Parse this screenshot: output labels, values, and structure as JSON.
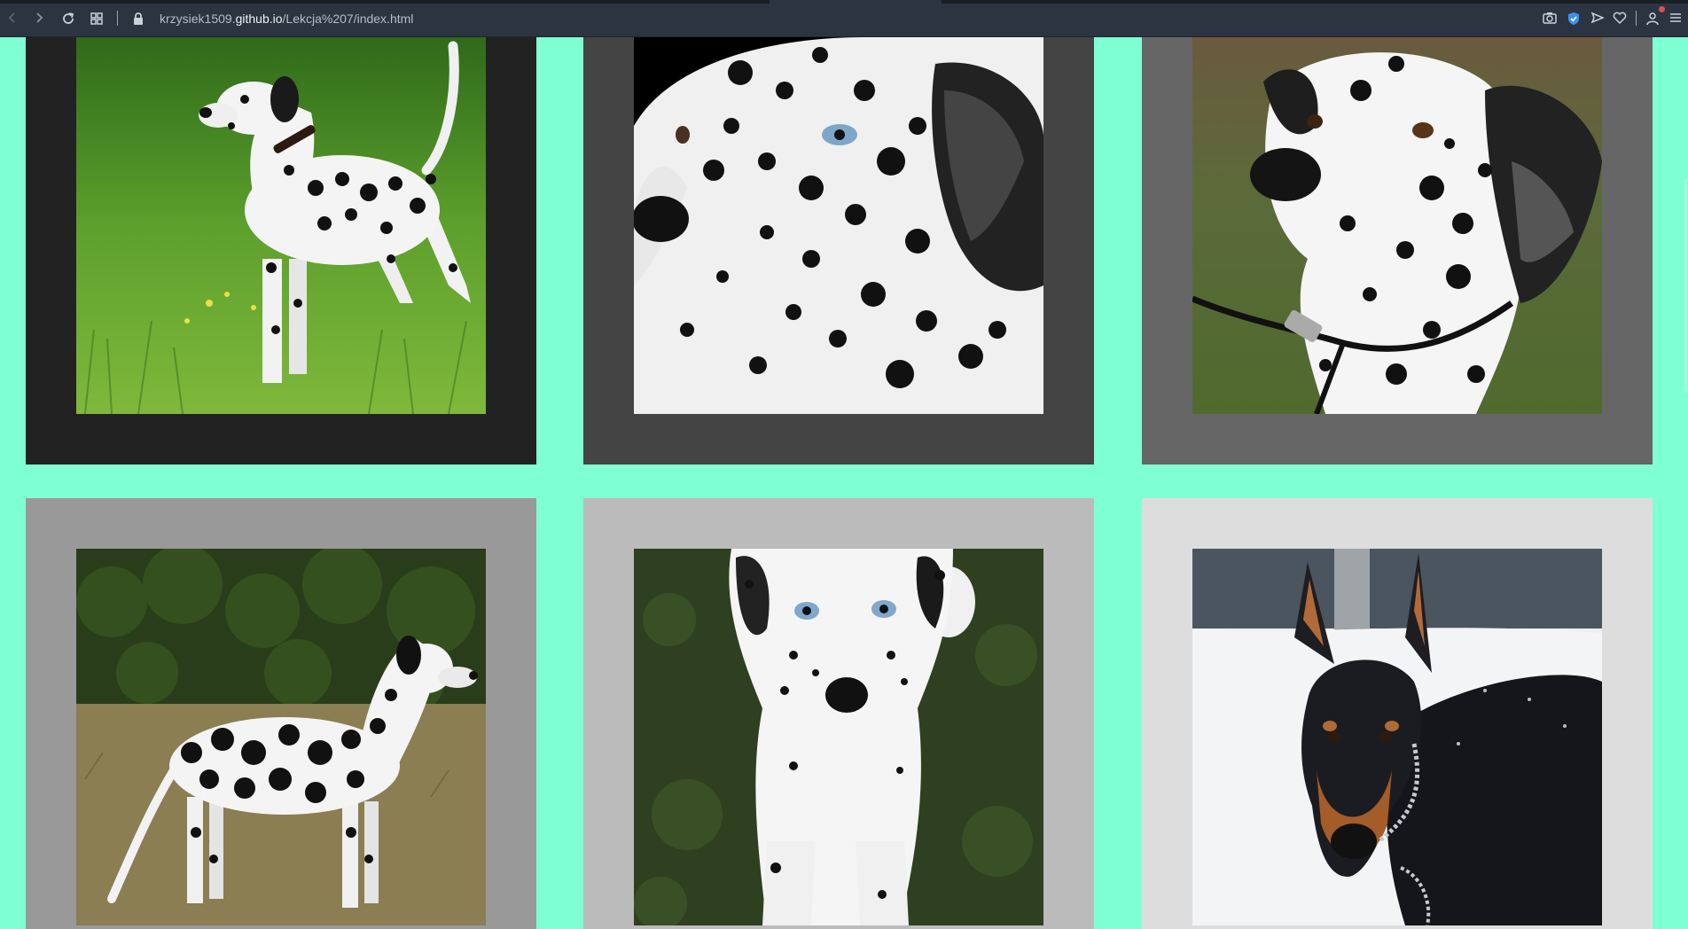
{
  "browser": {
    "url_prefix": "krzysiek1509.",
    "url_domain": "github.io",
    "url_path": "/Lekcja%207/index.html",
    "icons": [
      "back-icon",
      "forward-icon",
      "reload-icon",
      "tab-grid-icon",
      "lock-icon",
      "camera-icon",
      "shield-icon",
      "send-icon",
      "heart-icon",
      "profile-icon",
      "menu-icon"
    ]
  },
  "colors": {
    "page_background": "#7fffd4",
    "card_backgrounds": [
      "#222222",
      "#444444",
      "#666666",
      "#999999",
      "#bbbbbb",
      "#dddddd"
    ]
  },
  "gallery": {
    "cards": [
      {
        "subject": "dalmatian standing on grass"
      },
      {
        "subject": "dalmatian face close-up on black"
      },
      {
        "subject": "dalmatian with leash"
      },
      {
        "subject": "dalmatian side profile"
      },
      {
        "subject": "dalmatian puppy lying on grass"
      },
      {
        "subject": "doberman in snow"
      }
    ]
  }
}
